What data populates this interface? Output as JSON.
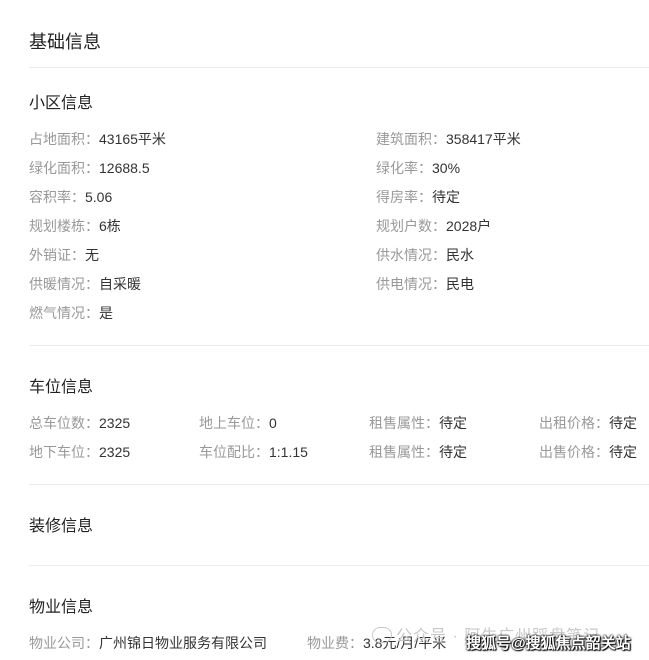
{
  "header": {
    "title": "基础信息"
  },
  "community": {
    "title": "小区信息",
    "items": [
      {
        "label": "占地面积：",
        "value": "43165平米"
      },
      {
        "label": "建筑面积：",
        "value": "358417平米"
      },
      {
        "label": "绿化面积：",
        "value": "12688.5"
      },
      {
        "label": "绿化率：",
        "value": "30%"
      },
      {
        "label": "容积率：",
        "value": "5.06"
      },
      {
        "label": "得房率：",
        "value": "待定"
      },
      {
        "label": "规划楼栋：",
        "value": "6栋"
      },
      {
        "label": "规划户数：",
        "value": "2028户"
      },
      {
        "label": "外销证：",
        "value": "无"
      },
      {
        "label": "供水情况：",
        "value": "民水"
      },
      {
        "label": "供暖情况：",
        "value": "自采暖"
      },
      {
        "label": "供电情况：",
        "value": "民电"
      },
      {
        "label": "燃气情况：",
        "value": "是"
      }
    ]
  },
  "parking": {
    "title": "车位信息",
    "items": [
      {
        "label": "总车位数：",
        "value": "2325"
      },
      {
        "label": "地上车位：",
        "value": "0"
      },
      {
        "label": "租售属性：",
        "value": "待定"
      },
      {
        "label": "出租价格：",
        "value": "待定"
      },
      {
        "label": "地下车位：",
        "value": "2325"
      },
      {
        "label": "车位配比：",
        "value": "1:1.15"
      },
      {
        "label": "租售属性：",
        "value": "待定"
      },
      {
        "label": "出售价格：",
        "value": "待定"
      }
    ]
  },
  "decoration": {
    "title": "装修信息"
  },
  "property": {
    "title": "物业信息",
    "items": [
      {
        "label": "物业公司：",
        "value": "广州锦日物业服务有限公司"
      },
      {
        "label": "物业费：",
        "value": "3.8元/月/平米"
      }
    ]
  },
  "watermark": {
    "text": "公众号 · 阿生广州踩盘笔记",
    "icon": "wechat-icon",
    "source": "搜狐号@搜狐焦点韶关站"
  },
  "colors": {
    "label": "#999999",
    "value": "#333333",
    "divider": "#ececec"
  }
}
